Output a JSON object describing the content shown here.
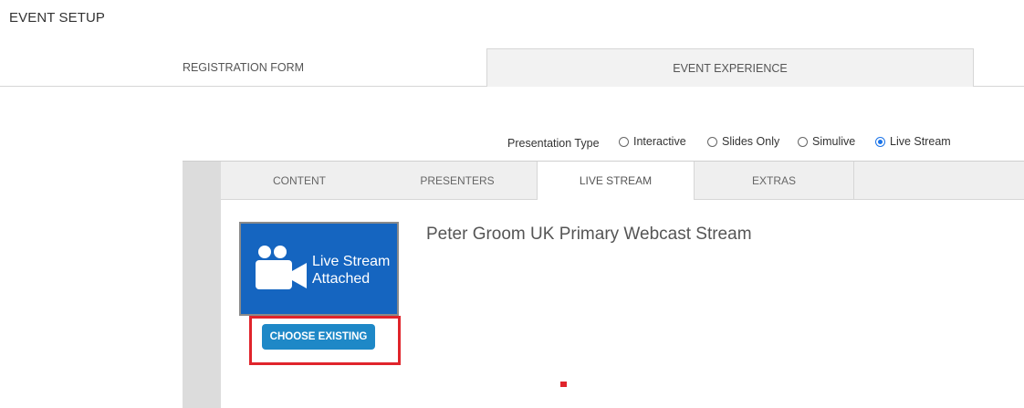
{
  "page": {
    "title": "EVENT SETUP"
  },
  "top_tabs": [
    {
      "label": "REGISTRATION FORM",
      "active": false
    },
    {
      "label": "EVENT EXPERIENCE",
      "active": true
    }
  ],
  "presentation_type": {
    "label": "Presentation Type",
    "options": [
      {
        "label": "Interactive",
        "checked": false
      },
      {
        "label": "Slides Only",
        "checked": false
      },
      {
        "label": "Simulive",
        "checked": false
      },
      {
        "label": "Live Stream",
        "checked": true
      }
    ]
  },
  "sub_tabs": [
    {
      "label": "CONTENT",
      "active": false
    },
    {
      "label": "PRESENTERS",
      "active": false
    },
    {
      "label": "LIVE STREAM",
      "active": true
    },
    {
      "label": "EXTRAS",
      "active": false
    }
  ],
  "live_stream": {
    "tile_line1": "Live Stream",
    "tile_line2": "Attached",
    "tile_icon": "video-camera-icon",
    "choose_button": "CHOOSE EXISTING",
    "stream_name": "Peter Groom UK Primary Webcast Stream"
  },
  "colors": {
    "tile_blue": "#1565c0",
    "button_blue": "#1e88c7",
    "highlight_red": "#e0242b",
    "radio_blue": "#1a73e8"
  }
}
